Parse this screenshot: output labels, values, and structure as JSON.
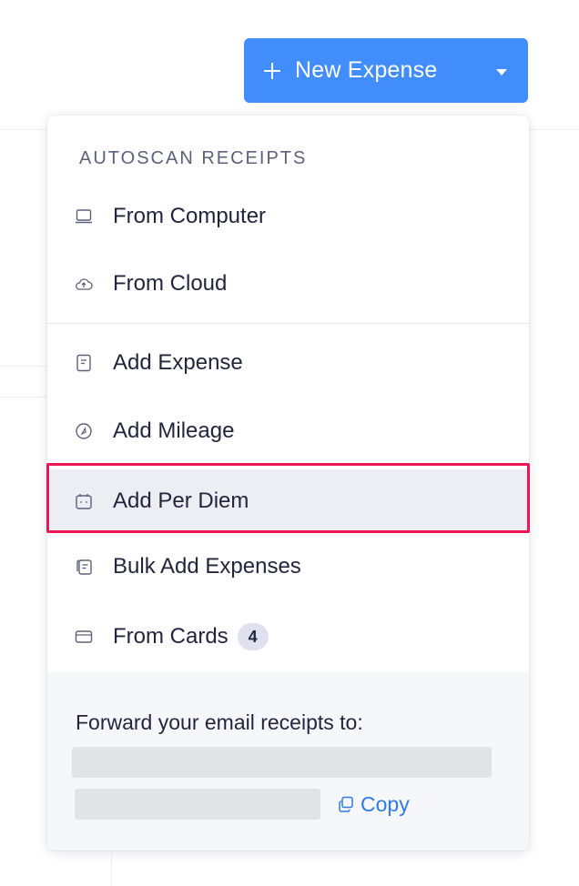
{
  "header": {
    "new_expense_label": "New Expense",
    "accent_color": "#408dfb"
  },
  "dropdown": {
    "section_heading": "AUTOSCAN RECEIPTS",
    "items": [
      {
        "label": "From Computer",
        "icon": "laptop-icon"
      },
      {
        "label": "From Cloud",
        "icon": "cloud-upload-icon"
      },
      {
        "label": "Add Expense",
        "icon": "receipt-icon"
      },
      {
        "label": "Add Mileage",
        "icon": "speedometer-icon"
      },
      {
        "label": "Add Per Diem",
        "icon": "per-diem-icon",
        "highlighted": true
      },
      {
        "label": "Bulk Add Expenses",
        "icon": "bulk-receipt-icon"
      },
      {
        "label": "From Cards",
        "icon": "card-icon",
        "badge": "4"
      }
    ],
    "footer": {
      "forward_text": "Forward your email receipts to:",
      "copy_label": "Copy"
    },
    "highlight_color": "#ee1651"
  }
}
